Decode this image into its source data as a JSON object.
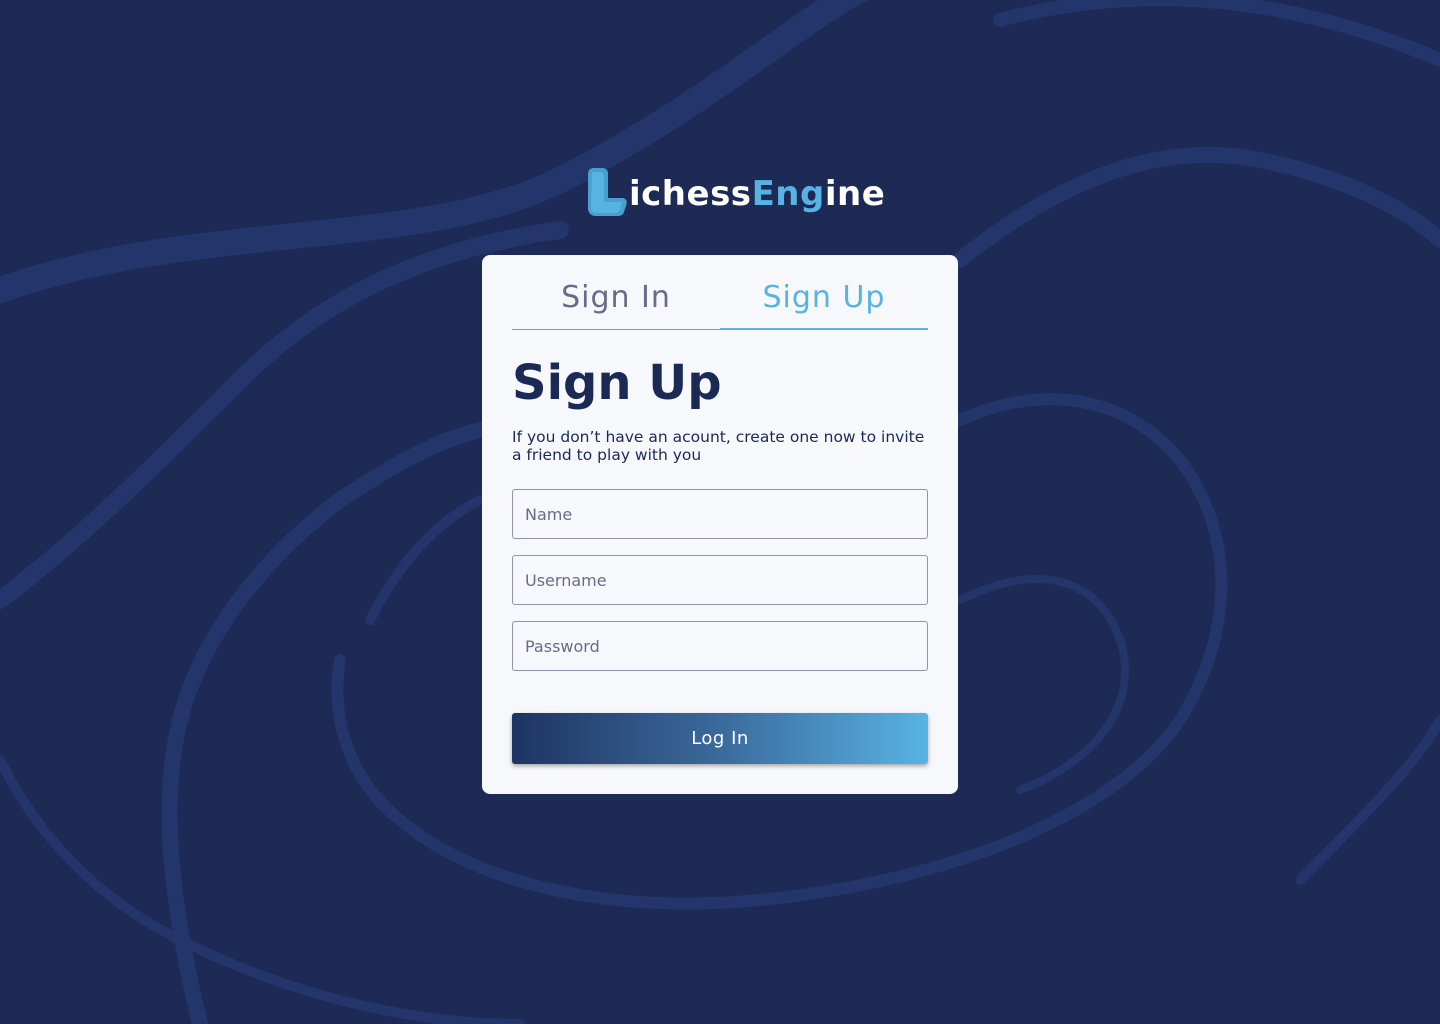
{
  "brand": {
    "name_part1": "ichess",
    "name_part2": "Eng",
    "name_part3": "ine",
    "logo_icon": "letter-l-icon"
  },
  "tabs": [
    {
      "label": "Sign In",
      "active": false
    },
    {
      "label": "Sign Up",
      "active": true
    }
  ],
  "form": {
    "title": "Sign Up",
    "subtitle": "If you don’t have an acount, create one now to invite a friend to play with you",
    "name_placeholder": "Name",
    "username_placeholder": "Username",
    "password_placeholder": "Password",
    "submit_label": "Log In"
  },
  "colors": {
    "background": "#1c2a55",
    "accent": "#58b3e4",
    "card": "#f7f8fc",
    "text_dark": "#1b2a55",
    "text_muted": "#676d88"
  }
}
